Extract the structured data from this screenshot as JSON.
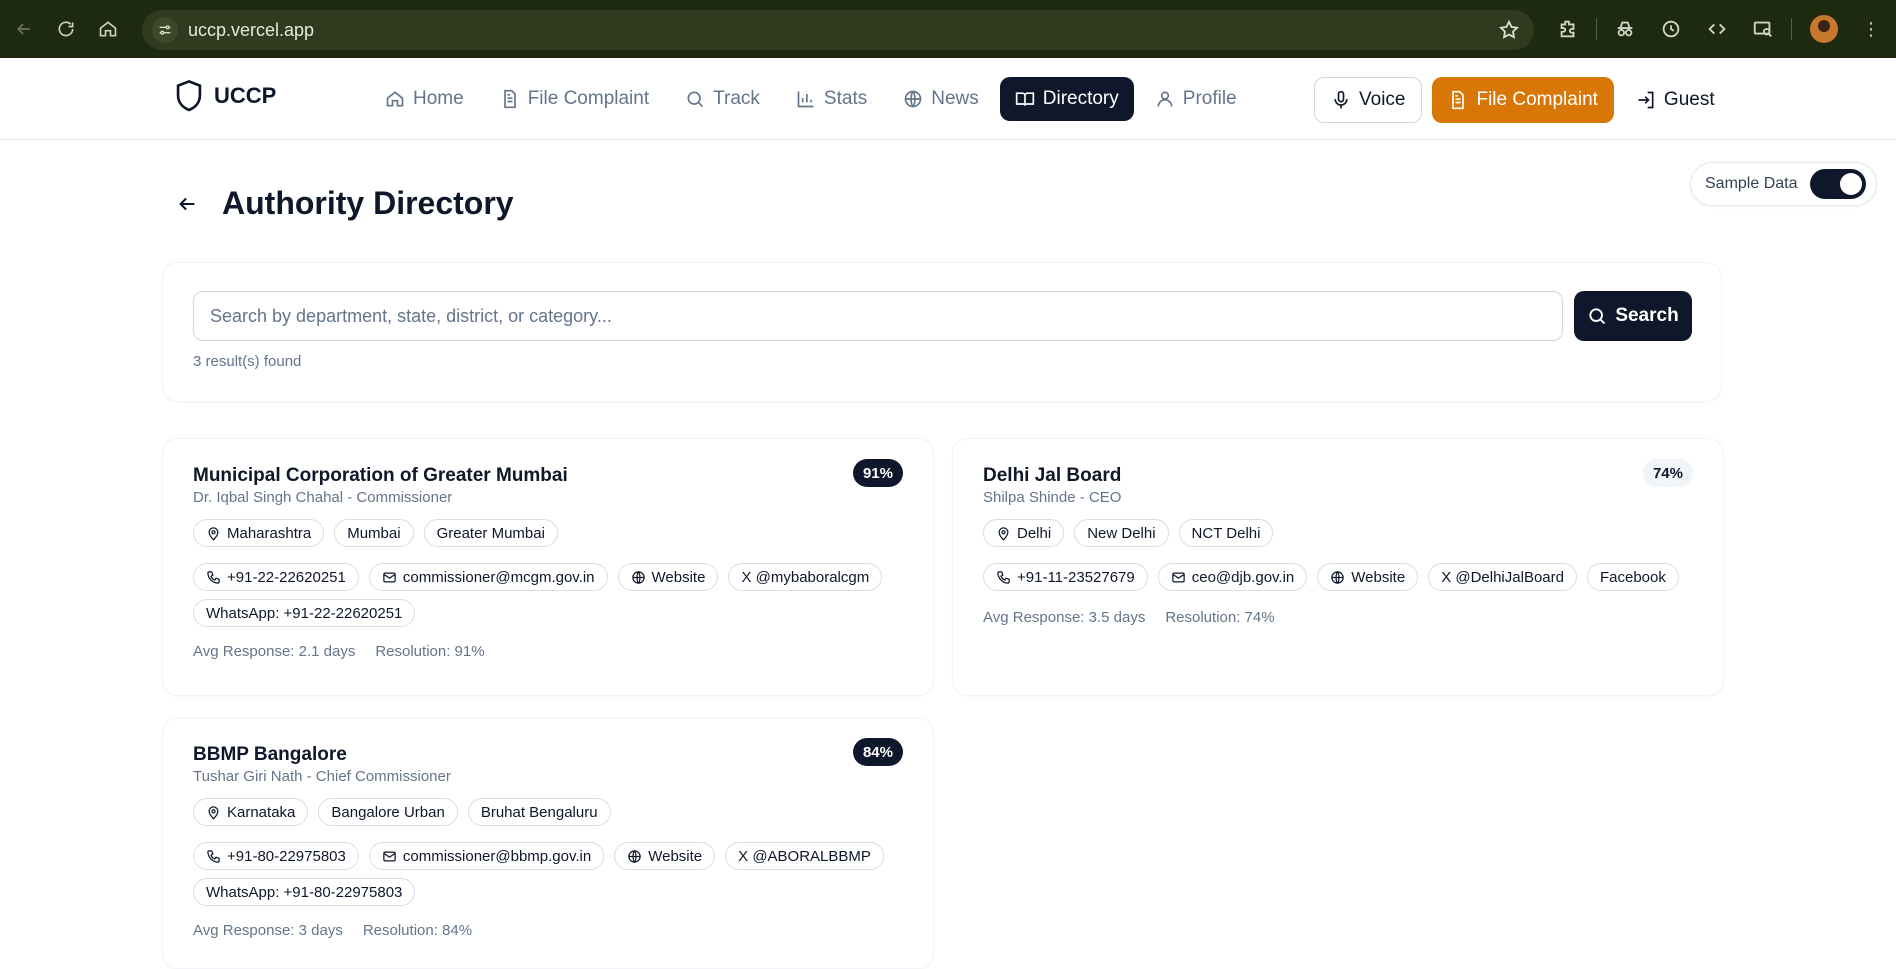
{
  "browser": {
    "url": "uccp.vercel.app"
  },
  "app": {
    "brand": "UCCP",
    "nav": [
      {
        "label": "Home",
        "icon": "home-icon"
      },
      {
        "label": "File Complaint",
        "icon": "file-icon"
      },
      {
        "label": "Track",
        "icon": "search-icon"
      },
      {
        "label": "Stats",
        "icon": "bar-chart-icon"
      },
      {
        "label": "News",
        "icon": "globe-icon"
      },
      {
        "label": "Directory",
        "icon": "book-icon",
        "active": true
      },
      {
        "label": "Profile",
        "icon": "user-icon"
      }
    ],
    "actions": {
      "voice": "Voice",
      "file_complaint": "File Complaint",
      "guest": "Guest"
    },
    "accent_color": "#d97706",
    "primary_color": "#0f172a"
  },
  "page": {
    "title": "Authority Directory",
    "sample_toggle_label": "Sample Data",
    "sample_toggle_on": true,
    "search_placeholder": "Search by department, state, district, or category...",
    "search_button": "Search",
    "result_count": "3 result(s) found"
  },
  "authorities": [
    {
      "name": "Municipal Corporation of Greater Mumbai",
      "official": "Dr. Iqbal Singh Chahal - Commissioner",
      "score": "91%",
      "score_style": "dark",
      "locations": [
        "Maharashtra",
        "Mumbai",
        "Greater Mumbai"
      ],
      "contacts": [
        {
          "type": "phone",
          "label": "+91-22-22620251"
        },
        {
          "type": "email",
          "label": "commissioner@mcgm.gov.in"
        },
        {
          "type": "website",
          "label": "Website"
        },
        {
          "type": "x",
          "label": "X @mybaboralcgm"
        },
        {
          "type": "whatsapp",
          "label": "WhatsApp: +91-22-22620251"
        }
      ],
      "avg_response": "Avg Response: 2.1 days",
      "resolution": "Resolution: 91%"
    },
    {
      "name": "Delhi Jal Board",
      "official": "Shilpa Shinde - CEO",
      "score": "74%",
      "score_style": "light",
      "locations": [
        "Delhi",
        "New Delhi",
        "NCT Delhi"
      ],
      "contacts": [
        {
          "type": "phone",
          "label": "+91-11-23527679"
        },
        {
          "type": "email",
          "label": "ceo@djb.gov.in"
        },
        {
          "type": "website",
          "label": "Website"
        },
        {
          "type": "x",
          "label": "X @DelhiJalBoard"
        },
        {
          "type": "facebook",
          "label": "Facebook"
        }
      ],
      "avg_response": "Avg Response: 3.5 days",
      "resolution": "Resolution: 74%"
    },
    {
      "name": "BBMP Bangalore",
      "official": "Tushar Giri Nath - Chief Commissioner",
      "score": "84%",
      "score_style": "dark",
      "locations": [
        "Karnataka",
        "Bangalore Urban",
        "Bruhat Bengaluru"
      ],
      "contacts": [
        {
          "type": "phone",
          "label": "+91-80-22975803"
        },
        {
          "type": "email",
          "label": "commissioner@bbmp.gov.in"
        },
        {
          "type": "website",
          "label": "Website"
        },
        {
          "type": "x",
          "label": "X @ABORALBBMP"
        },
        {
          "type": "whatsapp",
          "label": "WhatsApp: +91-80-22975803"
        }
      ],
      "avg_response": "Avg Response: 3 days",
      "resolution": "Resolution: 84%"
    }
  ]
}
